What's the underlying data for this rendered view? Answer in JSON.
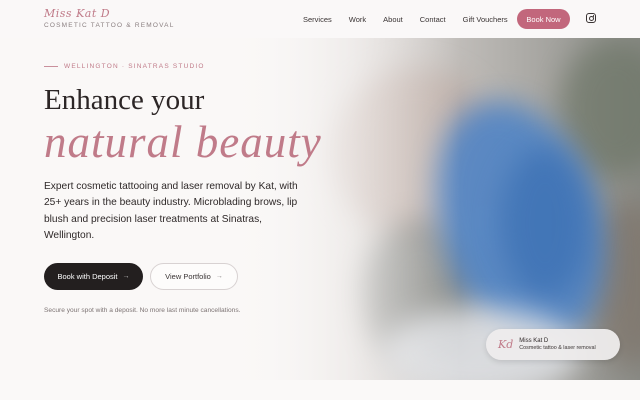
{
  "brand": {
    "logo": "Miss Kat D",
    "tagline": "COSMETIC TATTOO & REMOVAL"
  },
  "nav": {
    "links": [
      "Services",
      "Work",
      "About",
      "Contact",
      "Gift Vouchers"
    ],
    "book_now": "Book Now",
    "social_icon": "instagram-icon"
  },
  "hero": {
    "eyebrow": "WELLINGTON · SINATRAS STUDIO",
    "headline": "Enhance your",
    "headline_accent": "natural beauty",
    "description": "Expert cosmetic tattooing and laser removal by Kat, with 25+ years in the beauty industry. Microblading brows, lip blush and precision laser treatments at Sinatras, Wellington.",
    "primary_button": "Book with Deposit",
    "secondary_button": "View Portfolio",
    "button_arrow": "→",
    "note": "Secure your spot with a deposit. No more last minute cancellations."
  },
  "card": {
    "logo": "Kd",
    "name": "Miss Kat D",
    "role": "Cosmetic tattoo & laser removal"
  },
  "colors": {
    "accent": "#c07b89",
    "button_pink": "#c2677c",
    "dark": "#231f1f"
  }
}
